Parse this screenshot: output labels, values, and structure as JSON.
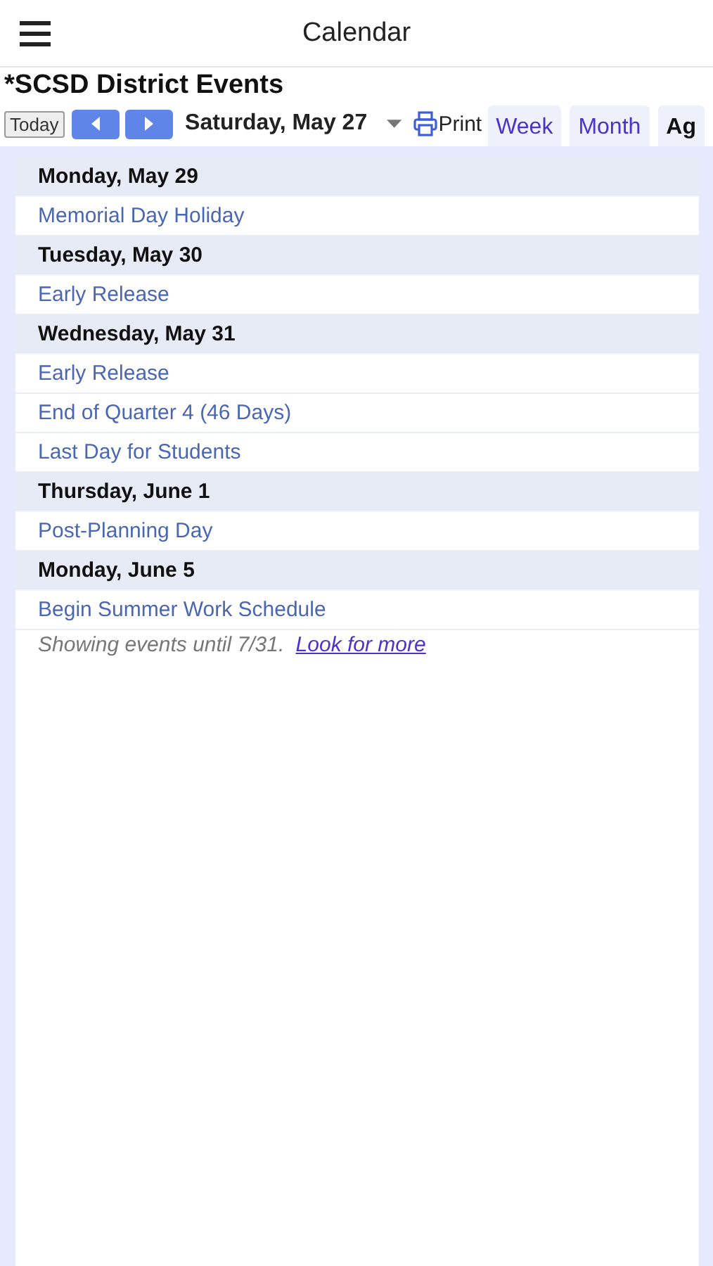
{
  "app_bar": {
    "title": "Calendar"
  },
  "calendar_title": "*SCSD District Events",
  "toolbar": {
    "today": "Today",
    "date": "Saturday, May 27",
    "print": "Print"
  },
  "tabs": [
    {
      "label": "Week",
      "selected": false
    },
    {
      "label": "Month",
      "selected": false
    },
    {
      "label": "Ag",
      "selected": true
    }
  ],
  "days": [
    {
      "date": "Monday, May 29",
      "events": [
        "Memorial Day Holiday"
      ]
    },
    {
      "date": "Tuesday, May 30",
      "events": [
        "Early Release"
      ]
    },
    {
      "date": "Wednesday, May 31",
      "events": [
        "Early Release",
        "End of Quarter 4 (46 Days)",
        "Last Day for Students"
      ]
    },
    {
      "date": "Thursday, June 1",
      "events": [
        "Post-Planning Day"
      ]
    },
    {
      "date": "Monday, June 5",
      "events": [
        "Begin Summer Work Schedule"
      ]
    }
  ],
  "footer": {
    "note": "Showing events until 7/31.",
    "link": "Look for more"
  }
}
